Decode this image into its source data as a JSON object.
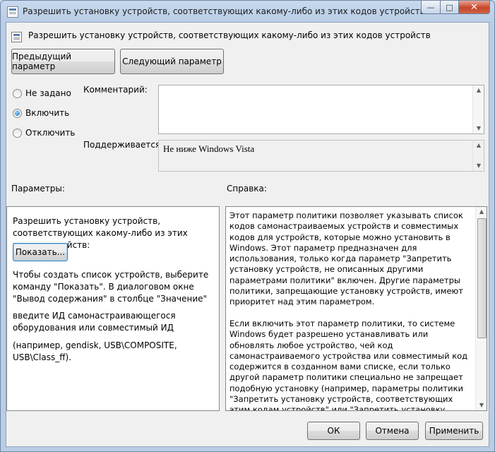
{
  "window": {
    "title": "Разрешить установку устройств, соответствующих какому-либо из этих кодов устройств",
    "controls": {
      "minimize": "—",
      "maximize": "□",
      "close": "✕"
    }
  },
  "header": {
    "policy_name": "Разрешить установку устройств, соответствующих какому-либо из этих кодов устройств"
  },
  "nav": {
    "prev_label": "Предыдущий параметр",
    "next_label": "Следующий параметр"
  },
  "state": {
    "options": [
      {
        "label": "Не задано",
        "checked": false
      },
      {
        "label": "Включить",
        "checked": true
      },
      {
        "label": "Отключить",
        "checked": false
      }
    ]
  },
  "comment": {
    "label": "Комментарий:",
    "value": ""
  },
  "supported": {
    "label": "Поддерживается:",
    "value": "Не ниже Windows Vista"
  },
  "params": {
    "label": "Параметры:",
    "intro": "Разрешить установку устройств, соответствующих какому-либо из этих кодов устройств:",
    "show_button": "Показать...",
    "hint1": "Чтобы создать список устройств, выберите команду \"Показать\". В диалоговом окне \"Вывод содержания\" в столбце \"Значение\"",
    "hint2": "введите ИД самонастраивающегося оборудования или совместимый ИД",
    "hint3": "(например, gendisk, USB\\COMPOSITE, USB\\Class_ff)."
  },
  "help": {
    "label": "Справка:",
    "text": "Этот параметр политики позволяет указывать список кодов самонастраиваемых устройств и совместимых кодов для устройств, которые можно установить в Windows. Этот параметр предназначен для использования, только когда параметр \"Запретить установку устройств, не описанных другими параметрами политики\" включен. Другие параметры политики, запрещающие установку устройств, имеют приоритет над этим параметром.\n\nЕсли включить этот параметр политики, то системе Windows будет разрешено устанавливать или обновлять любое устройство, чей код самонастраиваемого устройства или совместимый код содержится в созданном вами списке, если только другой параметр политики специально не запрещает подобную установку (например, параметры политики \"Запретить установку устройств, соответствующих этим кодам устройств\" или \"Запретить установку устройств для этих классов устройств\", или \"Запретить установку съемных устройств\"). Если включить этот параметр политики на"
  },
  "footer": {
    "ok_label": "ОК",
    "cancel_label": "Отмена",
    "apply_label": "Применить"
  }
}
